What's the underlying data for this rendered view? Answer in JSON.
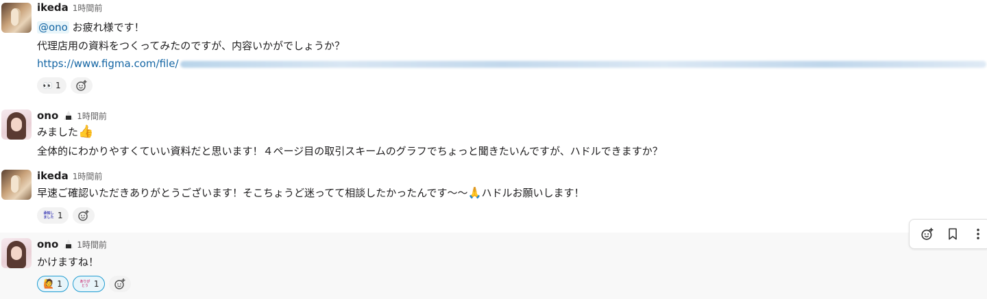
{
  "messages": [
    {
      "user": "ikeda",
      "time": "1時間前",
      "mention": "@ono",
      "line1_rest": " お疲れ様です！",
      "line2": "代理店用の資料をつくってみたのですが、内容いかがでしょうか？",
      "link_prefix": "https://www.figma.com/file/",
      "reactions": [
        {
          "emoji": "eyes-emoji",
          "glyph": "👀",
          "count": "1"
        }
      ]
    },
    {
      "user": "ono",
      "time": "1時間前",
      "status_icon": "onigiri-icon",
      "line1": "みました",
      "line1_emoji": "👍",
      "line2": "全体的にわかりやすくていい資料だと思います！４ページ目の取引スキームのグラフでちょっと聞きたいんですが、ハドルできますか？"
    },
    {
      "user": "ikeda",
      "time": "1時間前",
      "line1_a": "早速ご確認いただきありがとうございます！そこちょうど迷ってて相談したかったんです〜〜",
      "line1_emoji": "🙏",
      "line1_b": "ハドルお願いします！",
      "reactions": [
        {
          "emoji": "shouchi-shimashita-stamp",
          "glyph": "承知しました",
          "count": "1"
        }
      ]
    },
    {
      "user": "ono",
      "time": "1時間前",
      "status_icon": "onigiri-icon",
      "line1": "かけますね！",
      "reactions": [
        {
          "emoji": "person-raising-hand-emoji",
          "glyph": "🙋",
          "count": "1"
        },
        {
          "emoji": "arigatou-stamp",
          "glyph": "ありがとう",
          "count": "1"
        }
      ]
    }
  ],
  "toolbar": {
    "items": [
      "add-reaction-icon",
      "bookmark-icon",
      "more-actions-icon"
    ]
  },
  "colors": {
    "link": "#1264a3",
    "mention_bg": "#e8f5fa",
    "active_reaction_border": "#1d9bd1",
    "hover_bg": "#f8f8f8"
  }
}
